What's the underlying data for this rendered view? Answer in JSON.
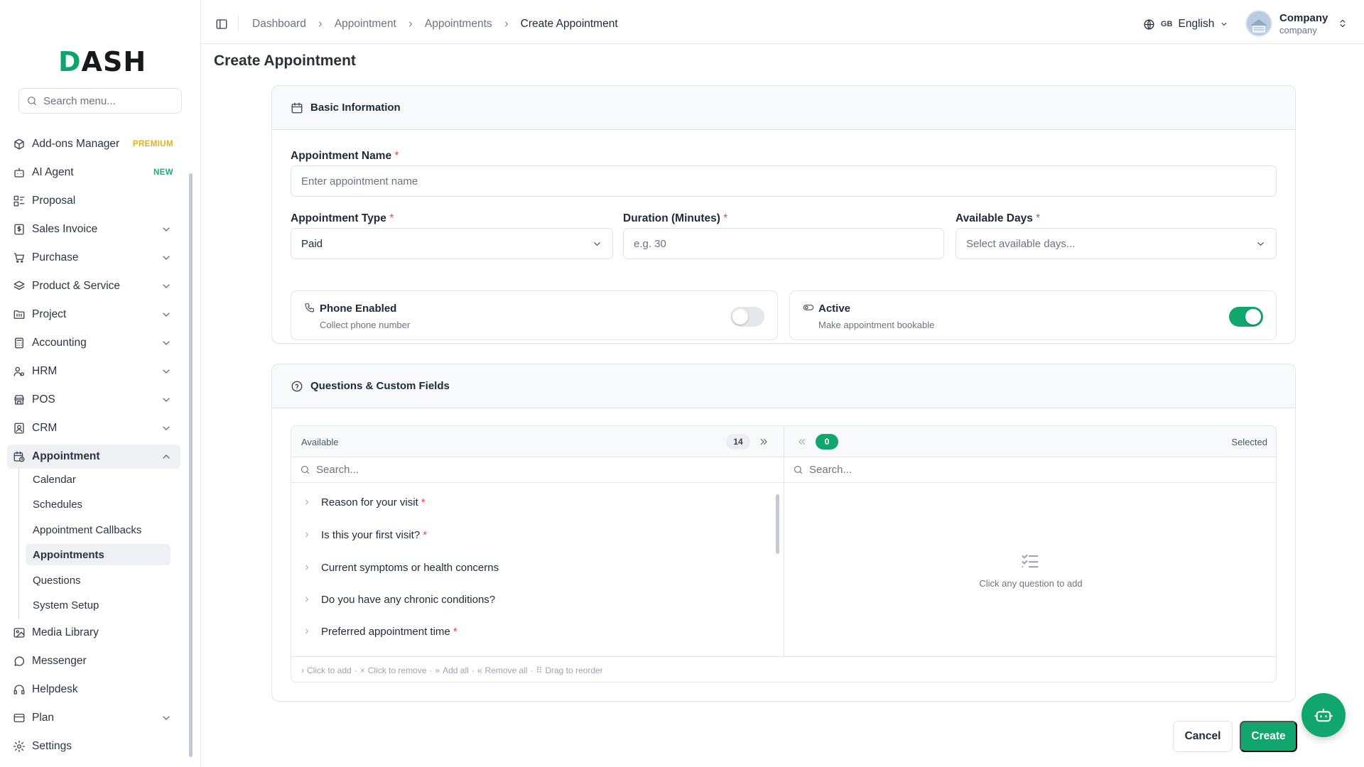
{
  "brand": {
    "logo_text": "DASH",
    "accent": "#12a66f"
  },
  "sidebar": {
    "search_placeholder": "Search menu...",
    "items": [
      {
        "label": "Add-ons Manager",
        "icon": "package-icon",
        "badge": "PREMIUM"
      },
      {
        "label": "AI Agent",
        "icon": "bot-icon",
        "badge": "NEW"
      },
      {
        "label": "Proposal",
        "icon": "proposal-icon"
      },
      {
        "label": "Sales Invoice",
        "icon": "invoice-icon"
      },
      {
        "label": "Purchase",
        "icon": "cart-icon"
      },
      {
        "label": "Product & Service",
        "icon": "layers-icon"
      },
      {
        "label": "Project",
        "icon": "folder-icon"
      },
      {
        "label": "Accounting",
        "icon": "calculator-icon"
      },
      {
        "label": "HRM",
        "icon": "users-icon"
      },
      {
        "label": "POS",
        "icon": "store-icon"
      },
      {
        "label": "CRM",
        "icon": "contact-icon"
      },
      {
        "label": "Appointment",
        "icon": "calendar-clock-icon"
      },
      {
        "label": "Media Library",
        "icon": "image-icon"
      },
      {
        "label": "Messenger",
        "icon": "chat-icon"
      },
      {
        "label": "Helpdesk",
        "icon": "headset-icon"
      },
      {
        "label": "Plan",
        "icon": "credit-card-icon"
      },
      {
        "label": "Settings",
        "icon": "gear-icon"
      }
    ],
    "appointment_sub": [
      "Calendar",
      "Schedules",
      "Appointment Callbacks",
      "Appointments",
      "Questions",
      "System Setup"
    ]
  },
  "topbar": {
    "breadcrumb": [
      "Dashboard",
      "Appointment",
      "Appointments",
      "Create Appointment"
    ],
    "lang_code": "GB",
    "language": "English",
    "user_name": "Company",
    "user_role": "company"
  },
  "page": {
    "title": "Create Appointment"
  },
  "basic": {
    "title": "Basic Information",
    "name_label": "Appointment Name",
    "name_placeholder": "Enter appointment name",
    "type_label": "Appointment Type",
    "type_value": "Paid",
    "duration_label": "Duration (Minutes)",
    "duration_placeholder": "e.g. 30",
    "days_label": "Available Days",
    "days_placeholder": "Select available days...",
    "required_mark": "*",
    "phone": {
      "title": "Phone Enabled",
      "desc": "Collect phone number",
      "on": false
    },
    "active": {
      "title": "Active",
      "desc": "Make appointment bookable",
      "on": true
    }
  },
  "questions": {
    "title": "Questions & Custom Fields",
    "available_label": "Available",
    "available_count": "14",
    "selected_label": "Selected",
    "selected_count": "0",
    "search_placeholder": "Search...",
    "items": [
      {
        "text": "Reason for your visit",
        "required": true
      },
      {
        "text": "Is this your first visit?",
        "required": true
      },
      {
        "text": "Current symptoms or health concerns",
        "required": false
      },
      {
        "text": "Do you have any chronic conditions?",
        "required": false
      },
      {
        "text": "Preferred appointment time",
        "required": true
      }
    ],
    "empty_text": "Click any question to add",
    "hints": [
      "Click to add",
      "Click to remove",
      "Add all",
      "Remove all",
      "Drag to reorder"
    ],
    "hint_sep": "·"
  },
  "actions": {
    "cancel": "Cancel",
    "create": "Create"
  }
}
